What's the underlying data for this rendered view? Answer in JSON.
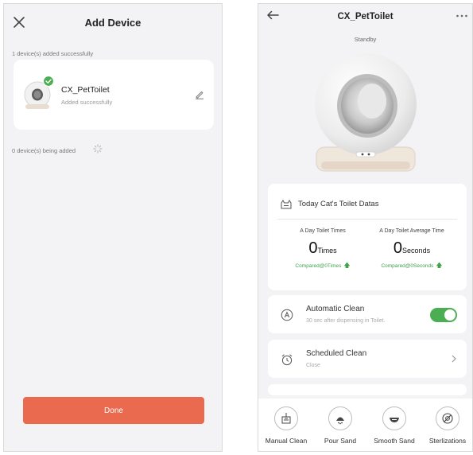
{
  "add_device": {
    "title": "Add Device",
    "added_status": "1 device(s) added successfully",
    "device": {
      "name": "CX_PetToilet",
      "status": "Added successfully"
    },
    "adding_status": "0 device(s) being added",
    "done_label": "Done",
    "icons": [
      "close-icon",
      "check-badge-icon",
      "edit-icon",
      "spinner-icon"
    ]
  },
  "device_page": {
    "title": "CX_PetToilet",
    "status": "Standby",
    "stats": {
      "title": "Today Cat's Toilet Datas",
      "times": {
        "label": "A Day Toilet Times",
        "value": "0",
        "unit": "Times",
        "compare": "Compared@0Times"
      },
      "average": {
        "label": "A Day Toilet Average Time",
        "value": "0",
        "unit": "Seconds",
        "compare": "Compared@0Seconds"
      }
    },
    "automatic_clean": {
      "title": "Automatic Clean",
      "subtitle": "30 sec after dispensing in Toilet."
    },
    "scheduled_clean": {
      "title": "Scheduled Clean",
      "subtitle": "Close"
    },
    "actions": [
      {
        "label": "Manual Clean",
        "icon": "broom-icon"
      },
      {
        "label": "Pour Sand",
        "icon": "pour-sand-icon"
      },
      {
        "label": "Smooth Sand",
        "icon": "smooth-sand-icon"
      },
      {
        "label": "Sterlizations",
        "icon": "sterilization-icon"
      }
    ]
  },
  "colors": {
    "accent_orange": "#e96a4f",
    "toggle_green": "#4cae52",
    "compare_green": "#3ea34a",
    "screen_bg": "#f3f3f5"
  }
}
